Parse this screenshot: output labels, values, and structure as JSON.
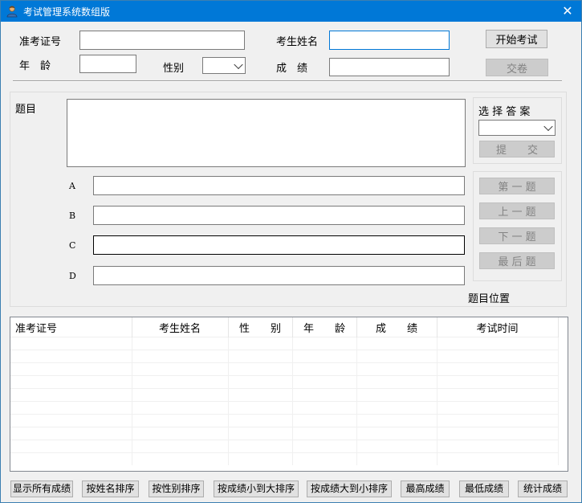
{
  "window": {
    "title": "考试管理系统数组版",
    "close_glyph": "✕"
  },
  "form": {
    "exam_id_label": "准考证号",
    "name_label": "考生姓名",
    "age_label": "年　龄",
    "gender_label": "性别",
    "score_label": "成　绩",
    "exam_id_value": "",
    "name_value": "",
    "age_value": "",
    "gender_value": "",
    "score_value": "",
    "start_button": "开始考试",
    "submit_paper_button": "交卷"
  },
  "question": {
    "label": "题目",
    "text": "",
    "options": [
      {
        "letter": "A",
        "value": ""
      },
      {
        "letter": "B",
        "value": ""
      },
      {
        "letter": "C",
        "value": ""
      },
      {
        "letter": "D",
        "value": ""
      }
    ],
    "position_label": "题目位置"
  },
  "answer_panel": {
    "title": "选 择 答 案",
    "selected": "",
    "submit_button": "提　　交"
  },
  "nav": {
    "first": "第 一 题",
    "prev": "上 一 题",
    "next": "下 一 题",
    "last": "最 后 题"
  },
  "grid": {
    "columns": [
      "准考证号",
      "考生姓名",
      "性　　别",
      "年　　龄",
      "成　　绩",
      "考试时间"
    ],
    "rows": []
  },
  "actions": {
    "show_all": "显示所有成绩",
    "sort_name": "按姓名排序",
    "sort_gender": "按性别排序",
    "sort_score_asc": "按成绩小到大排序",
    "sort_score_desc": "按成绩大到小排序",
    "max_score": "最高成绩",
    "min_score": "最低成绩",
    "stats": "统计成绩"
  },
  "colors": {
    "titlebar": "#0078d7",
    "window_bg": "#f0f0f0",
    "focus_border": "#0078d7"
  },
  "icons": {
    "app": "user-icon",
    "close": "close-icon",
    "dropdown": "chevron-down-icon"
  }
}
